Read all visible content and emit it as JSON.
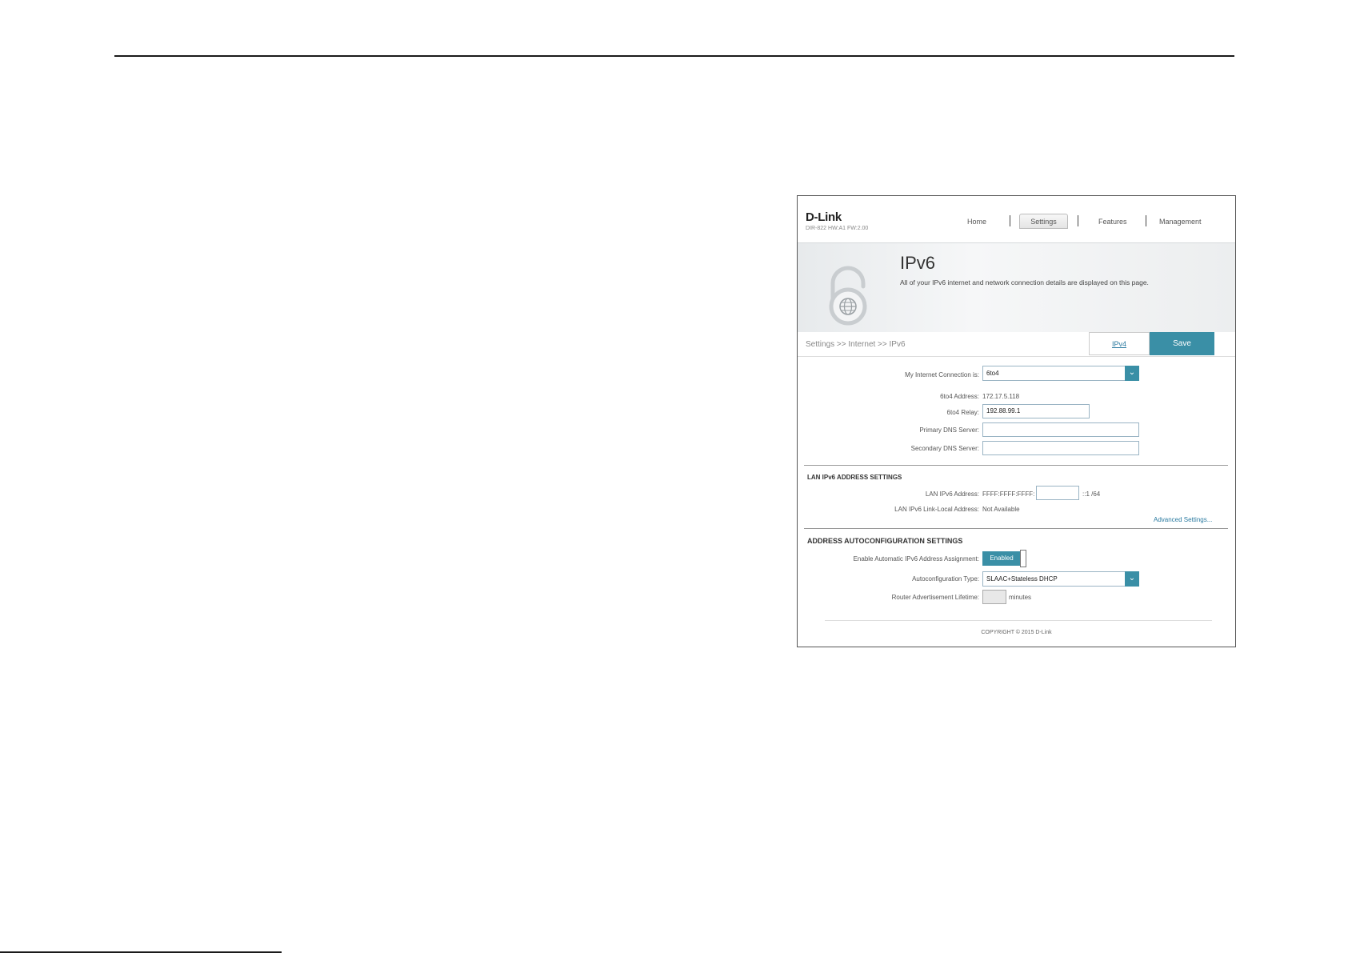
{
  "header": {
    "brand": "D-Link",
    "model": "DIR-822 HW:A1 FW:2.00",
    "nav": {
      "home": "Home",
      "settings": "Settings",
      "features": "Features",
      "management": "Management"
    }
  },
  "banner": {
    "title": "IPv6",
    "description": "All of your IPv6 internet and network connection details are displayed on this page.",
    "icon": "lock-globe-icon"
  },
  "breadcrumb": "Settings >> Internet >> IPv6",
  "actions": {
    "ipv4": "IPv4",
    "save": "Save"
  },
  "connection": {
    "my_connection_label": "My Internet Connection is:",
    "my_connection_value": "6to4",
    "address_label": "6to4 Address:",
    "address_value": "172.17.5.118",
    "relay_label": "6to4 Relay:",
    "relay_value": "192.88.99.1",
    "primary_dns_label": "Primary DNS Server:",
    "primary_dns_value": "",
    "secondary_dns_label": "Secondary DNS Server:",
    "secondary_dns_value": ""
  },
  "lan": {
    "section_title": "LAN IPv6 ADDRESS SETTINGS",
    "address_label": "LAN IPv6 Address:",
    "address_prefix": "FFFF:FFFF:FFFF:",
    "address_value": "",
    "address_suffix": "::1 /64",
    "link_local_label": "LAN IPv6 Link-Local Address:",
    "link_local_value": "Not Available",
    "advanced_link": "Advanced Settings..."
  },
  "autoconfig": {
    "section_title": "ADDRESS AUTOCONFIGURATION SETTINGS",
    "enable_label": "Enable Automatic IPv6 Address Assignment:",
    "enable_value": "Enabled",
    "type_label": "Autoconfiguration Type:",
    "type_value": "SLAAC+Stateless DHCP",
    "lifetime_label": "Router Advertisement Lifetime:",
    "lifetime_unit": "minutes"
  },
  "footer": {
    "copyright": "COPYRIGHT © 2015 D-Link"
  },
  "colors": {
    "accent": "#3a8fa6",
    "link": "#2a7aa0"
  }
}
